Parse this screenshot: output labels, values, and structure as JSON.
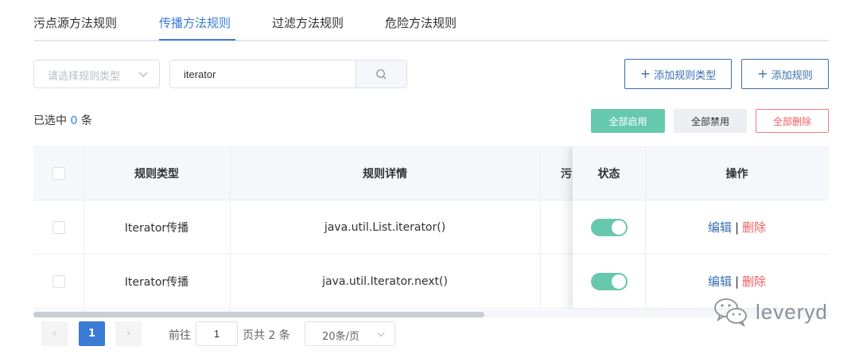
{
  "tabs": [
    {
      "label": "污点源方法规则",
      "active": false
    },
    {
      "label": "传播方法规则",
      "active": true
    },
    {
      "label": "过滤方法规则",
      "active": false
    },
    {
      "label": "危险方法规则",
      "active": false
    }
  ],
  "filter": {
    "rule_type_placeholder": "请选择规则类型",
    "search_value": "iterator"
  },
  "actions": {
    "add_rule_type": "添加规则类型",
    "add_rule": "添加规则",
    "enable_all": "全部启用",
    "disable_all": "全部禁用",
    "delete_all": "全部删除"
  },
  "selection": {
    "prefix": "已选中",
    "count": "0",
    "suffix": "条"
  },
  "table": {
    "headers": {
      "rule_type": "规则类型",
      "rule_detail": "规则详情",
      "truncated": "污",
      "status": "状态",
      "operation": "操作"
    },
    "rows": [
      {
        "rule_type": "Iterator传播",
        "rule_detail": "java.util.List.iterator()",
        "enabled": true,
        "edit": "编辑",
        "sep": "|",
        "delete": "删除"
      },
      {
        "rule_type": "Iterator传播",
        "rule_detail": "java.util.Iterator.next()",
        "enabled": true,
        "edit": "编辑",
        "sep": "|",
        "delete": "删除"
      }
    ]
  },
  "pagination": {
    "prev": "‹",
    "current_page": "1",
    "next": "›",
    "goto_label": "前往",
    "goto_value": "1",
    "total_text": "页共 2 条",
    "page_size": "20条/页"
  },
  "watermark": {
    "text": "leveryd"
  },
  "colors": {
    "accent": "#3a7bd5",
    "primary_outline": "#3a6fb0",
    "success": "#66c9ae",
    "danger": "#f05d5d"
  }
}
